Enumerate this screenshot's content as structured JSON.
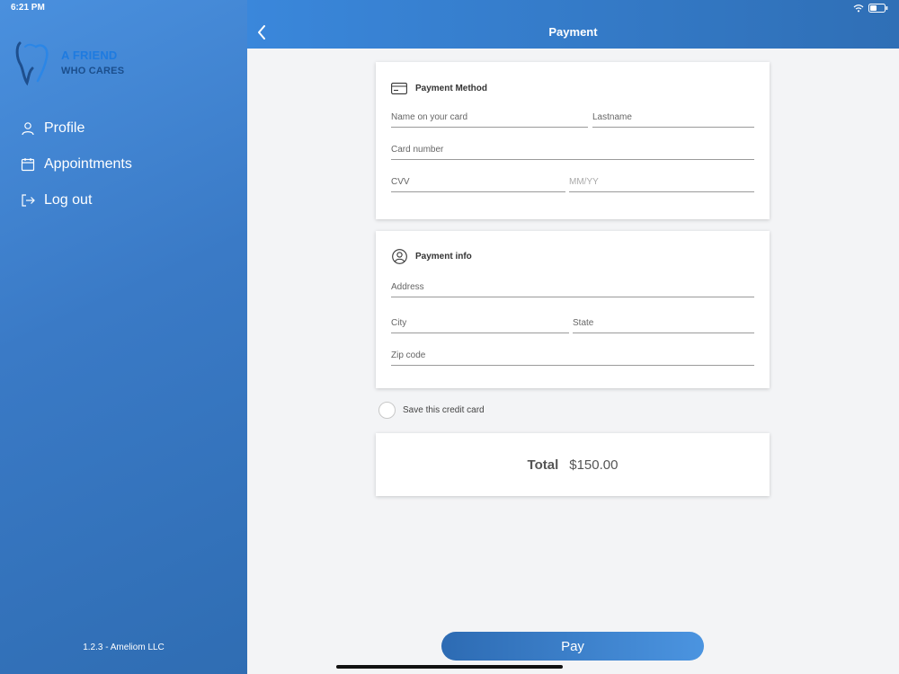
{
  "status_bar": {
    "time": "6:21 PM"
  },
  "sidebar": {
    "logo": {
      "line1": "A FRIEND",
      "line2": "WHO CARES"
    },
    "items": [
      {
        "label": "Profile",
        "icon": "user-icon"
      },
      {
        "label": "Appointments",
        "icon": "calendar-icon"
      },
      {
        "label": "Log out",
        "icon": "logout-icon"
      }
    ],
    "version": "1.2.3 - Ameliom LLC"
  },
  "header": {
    "title": "Payment"
  },
  "payment_method": {
    "title": "Payment Method",
    "name_placeholder": "Name on your card",
    "lastname_placeholder": "Lastname",
    "card_number_placeholder": "Card number",
    "cvv_placeholder": "CVV",
    "expiry_placeholder": "MM/YY"
  },
  "payment_info": {
    "title": "Payment info",
    "address_placeholder": "Address",
    "city_placeholder": "City",
    "state_placeholder": "State",
    "zip_placeholder": "Zip code"
  },
  "save_card": {
    "label": "Save this credit card",
    "checked": false
  },
  "total": {
    "label": "Total",
    "value": "$150.00"
  },
  "pay_button": {
    "label": "Pay"
  },
  "colors": {
    "accent": "#3a87db",
    "sidebar": "#3a7ac6",
    "background": "#f3f4f6"
  }
}
